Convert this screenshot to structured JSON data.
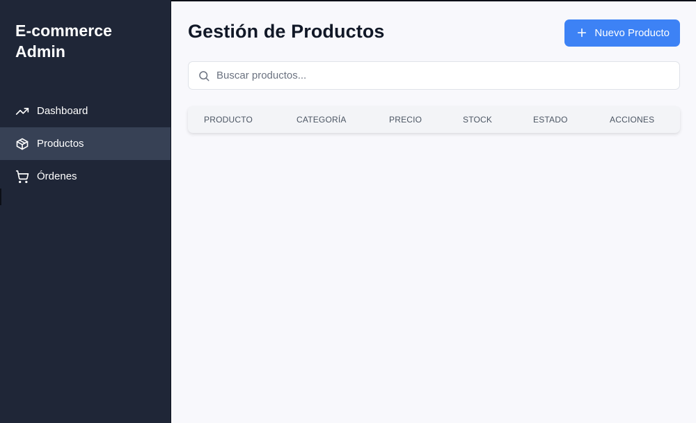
{
  "sidebar": {
    "brand_line1": "E-commerce",
    "brand_line2": "Admin",
    "items": [
      {
        "label": "Dashboard",
        "icon": "trending-up-icon",
        "active": false
      },
      {
        "label": "Productos",
        "icon": "box-icon",
        "active": true
      },
      {
        "label": "Órdenes",
        "icon": "cart-icon",
        "active": false
      }
    ]
  },
  "header": {
    "title": "Gestión de Productos",
    "new_button_label": "Nuevo Producto"
  },
  "search": {
    "placeholder": "Buscar productos...",
    "value": ""
  },
  "table": {
    "columns": [
      "Producto",
      "Categoría",
      "Precio",
      "Stock",
      "Estado",
      "Acciones"
    ],
    "rows": []
  },
  "colors": {
    "sidebar_bg": "#1f2637",
    "active_item_bg": "#374155",
    "accent": "#3d82f5",
    "main_bg": "#f8f8fc"
  }
}
